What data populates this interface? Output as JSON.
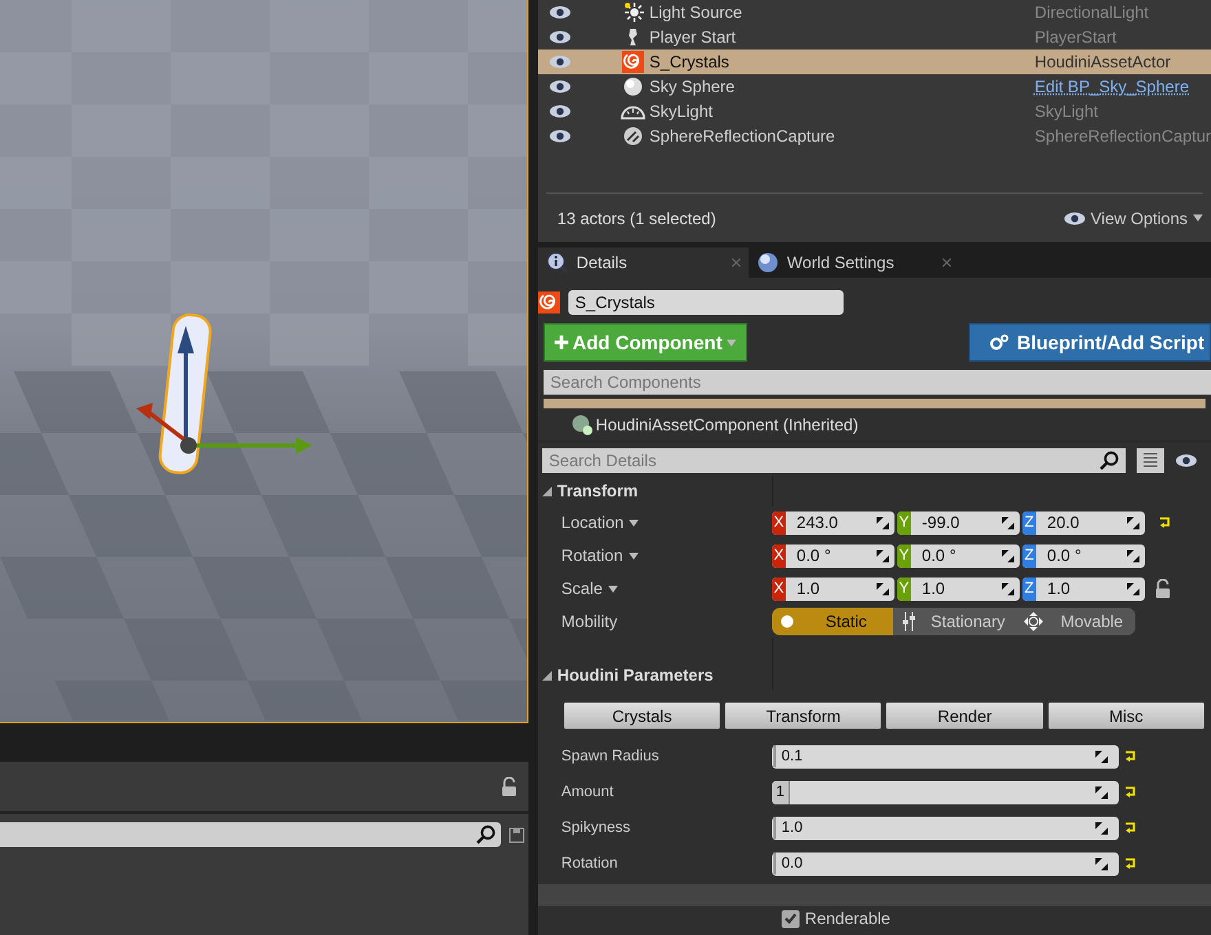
{
  "outliner": {
    "rows": [
      {
        "label": "Light Source",
        "type": "DirectionalLight",
        "visible": true,
        "selected": false,
        "type_is_link": false
      },
      {
        "label": "Player Start",
        "type": "PlayerStart",
        "visible": true,
        "selected": false,
        "type_is_link": false
      },
      {
        "label": "S_Crystals",
        "type": "HoudiniAssetActor",
        "visible": true,
        "selected": true,
        "type_is_link": false
      },
      {
        "label": "Sky Sphere",
        "type": "Edit BP_Sky_Sphere",
        "visible": true,
        "selected": false,
        "type_is_link": true
      },
      {
        "label": "SkyLight",
        "type": "SkyLight",
        "visible": true,
        "selected": false,
        "type_is_link": false
      },
      {
        "label": "SphereReflectionCapture",
        "type": "SphereReflectionCaptur",
        "visible": true,
        "selected": false,
        "type_is_link": false
      }
    ],
    "status": "13 actors (1 selected)",
    "view_options": "View Options"
  },
  "details": {
    "tabs": [
      {
        "label": "Details",
        "selected": true
      },
      {
        "label": "World Settings",
        "selected": false
      }
    ],
    "actor_name": "S_Crystals",
    "add_component": "Add Component",
    "blueprint": "Blueprint/Add Script",
    "search_components": {
      "placeholder": "Search Components"
    },
    "component": "HoudiniAssetComponent (Inherited)",
    "search_details": {
      "placeholder": "Search Details"
    },
    "transform": {
      "title": "Transform",
      "expanded": true,
      "rows": [
        {
          "label": "Location",
          "modified": true,
          "values": [
            {
              "axis": "X",
              "value": "243.0"
            },
            {
              "axis": "Y",
              "value": "-99.0"
            },
            {
              "axis": "Z",
              "value": "20.0"
            }
          ]
        },
        {
          "label": "Rotation",
          "modified": false,
          "values": [
            {
              "axis": "X",
              "value": "0.0 °"
            },
            {
              "axis": "Y",
              "value": "0.0 °"
            },
            {
              "axis": "Z",
              "value": "0.0 °"
            }
          ]
        },
        {
          "label": "Scale",
          "modified": false,
          "ratio_locked": false,
          "values": [
            {
              "axis": "X",
              "value": "1.0"
            },
            {
              "axis": "Y",
              "value": "1.0"
            },
            {
              "axis": "Z",
              "value": "1.0"
            }
          ]
        }
      ],
      "mobility": {
        "label": "Mobility",
        "options": [
          {
            "label": "Static",
            "selected": true
          },
          {
            "label": "Stationary",
            "selected": false
          },
          {
            "label": "Movable",
            "selected": false
          }
        ]
      }
    },
    "houdini": {
      "title": "Houdini Parameters",
      "expanded": true,
      "tabs": [
        {
          "label": "Crystals"
        },
        {
          "label": "Transform"
        },
        {
          "label": "Render"
        },
        {
          "label": "Misc"
        }
      ],
      "params": [
        {
          "label": "Spawn Radius",
          "value": "0.1",
          "kind": "float",
          "modified": true
        },
        {
          "label": "Amount",
          "value": "1",
          "kind": "int",
          "modified": true
        },
        {
          "label": "Spikyness",
          "value": "1.0",
          "kind": "float",
          "modified": true
        },
        {
          "label": "Rotation",
          "value": "0.0",
          "kind": "float",
          "modified": true
        }
      ],
      "renderable": {
        "label": "Renderable",
        "checked": true
      }
    }
  }
}
